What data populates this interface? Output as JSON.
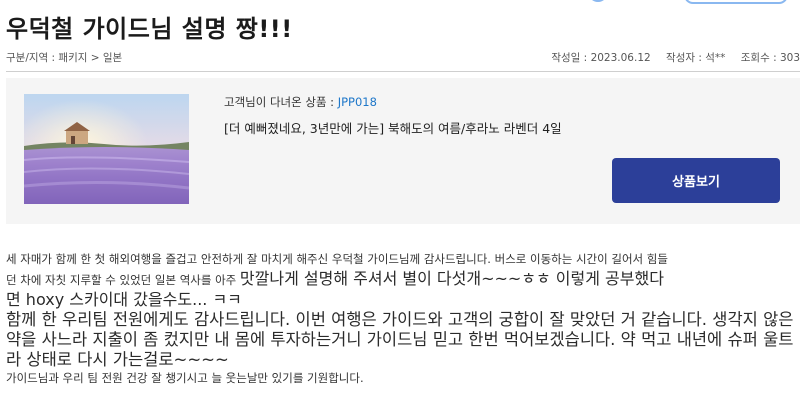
{
  "post": {
    "title": "우덕철 가이드님 설명 짱!!!",
    "breadcrumb_label": "구분/지역 :",
    "breadcrumb_category": "패키지",
    "breadcrumb_sep": ">",
    "breadcrumb_region": "일본",
    "date_label": "작성일 :",
    "date": "2023.06.12",
    "author_label": "작성자 :",
    "author": "석**",
    "views_label": "조회수 :",
    "views": "303"
  },
  "product": {
    "code_label": "고객님이 다녀온 상품 :",
    "code": "JPP018",
    "name": "[더 예뻐졌네요, 3년만에 가는] 북해도의 여름/후라노 라벤더 4일",
    "button_label": "상품보기",
    "image_icon": "lavender-field-photo"
  },
  "body": {
    "line1": " 세 자매가 함께 한 첫 해외여행을 즐겁고 안전하게 잘 마치게 해주신 우덕철 가이드님께 감사드립니다. 버스로 이동하는 시간이 길어서 힘들",
    "line2_small": "던 차에 자칫 지루할 수 있었던 일본 역사를 아주 ",
    "line2_big": "맛깔나게 설명해 주셔서 별이 다섯개~~~ㅎㅎ 이렇게 공부했다",
    "line3": "면 hoxy 스카이대 갔을수도... ㅋㅋ",
    "para2": "함께 한 우리팀 전원에게도 감사드립니다. 이번 여행은 가이드와 고객의 궁합이 잘 맞았던 거 같습니다. 생각지 않은 약을 사느라 지출이 좀 컸지만 내 몸에 투자하는거니 가이드님 믿고 한번 먹어보겠습니다. 약 먹고 내년에 슈퍼 울트라 상태로 다시 가는걸로~~~~",
    "para3": "가이드님과 우리 팀 전원 건강 잘 챙기시고 늘 웃는날만 있기를 기원합니다."
  }
}
